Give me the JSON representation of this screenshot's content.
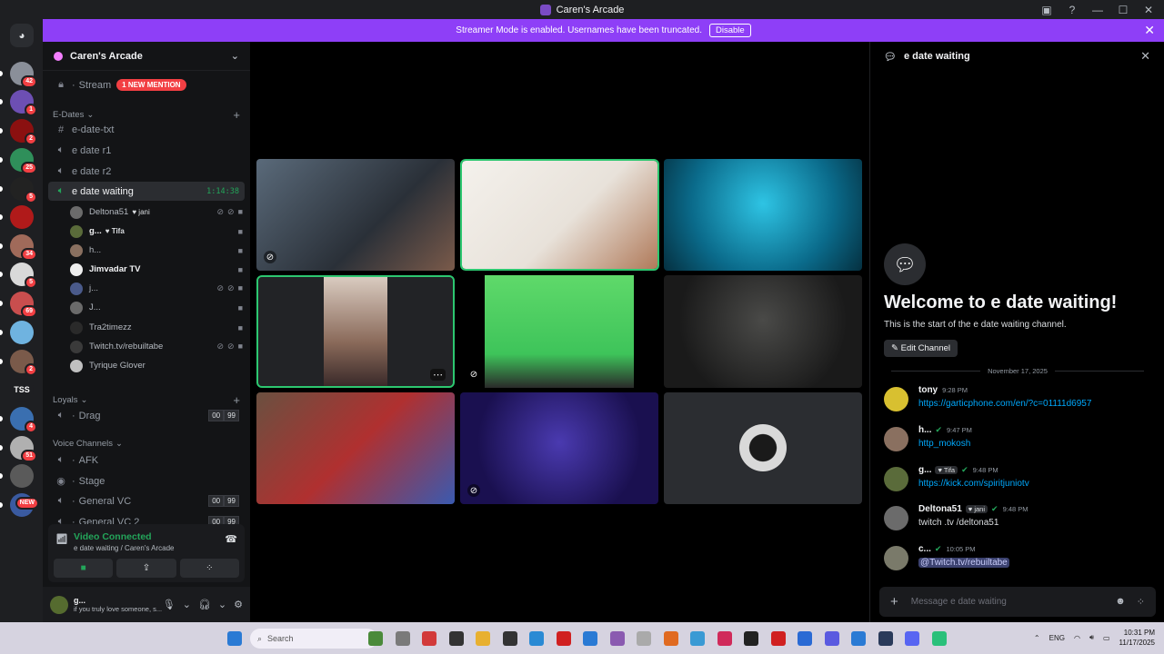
{
  "window": {
    "title": "Caren's Arcade"
  },
  "banner": {
    "text": "Streamer Mode is enabled. Usernames have been truncated.",
    "button": "Disable"
  },
  "rail": {
    "servers": [
      {
        "badge": "42",
        "color": "#8a8f99"
      },
      {
        "badge": "1",
        "color": "#6d4fb3"
      },
      {
        "badge": "2",
        "color": "#8b1010"
      },
      {
        "badge": "25",
        "color": "#2f8f5a"
      },
      {
        "badge": "5",
        "color": "#222222"
      },
      {
        "badge": "",
        "color": "#b01a1a"
      },
      {
        "badge": "34",
        "color": "#a06a5a"
      },
      {
        "badge": "5",
        "color": "#d9d9d9"
      },
      {
        "badge": "69",
        "color": "#c94e4e"
      },
      {
        "badge": "",
        "color": "#6fb3e0"
      },
      {
        "badge": "2",
        "color": "#7a5a4a"
      },
      {
        "badge": "TSS",
        "color": "#1e1f22"
      },
      {
        "badge": "4",
        "color": "#3a6fb0"
      },
      {
        "badge": "51",
        "color": "#b0b0b0"
      },
      {
        "badge": "",
        "color": "#5a5a5a"
      },
      {
        "badge": "NEW",
        "color": "#3a5aa0"
      }
    ]
  },
  "sidebar": {
    "server_name": "Caren's Arcade",
    "stream": {
      "name": "Stream",
      "mention": "1 NEW MENTION"
    },
    "cat_edates": "E-Dates",
    "channels": [
      "e-date-txt",
      "e date r1",
      "e date r2"
    ],
    "active": {
      "name": "e date waiting",
      "timer": "1:14:38"
    },
    "users": [
      {
        "name": "Deltona51",
        "tag": "♥ jani",
        "color": "#6b6b6b",
        "bold": false
      },
      {
        "name": "g...",
        "tag": "♥ Tifa",
        "color": "#5a6b3a",
        "bold": true
      },
      {
        "name": "h...",
        "tag": "",
        "color": "#8a7060",
        "bold": false
      },
      {
        "name": "Jimvadar TV",
        "tag": "",
        "color": "#eeeeee",
        "bold": true
      },
      {
        "name": "j...",
        "tag": "",
        "color": "#4a5a8a",
        "bold": false
      },
      {
        "name": "J...",
        "tag": "",
        "color": "#6a6a6a",
        "bold": false
      },
      {
        "name": "Tra2timezz",
        "tag": "",
        "color": "#2a2a2a",
        "bold": false
      },
      {
        "name": "Twitch.tv/rebuiltabe",
        "tag": "",
        "color": "#3a3a3a",
        "bold": false
      },
      {
        "name": "Tyrique Glover",
        "tag": "",
        "color": "#c0c0c0",
        "bold": false
      }
    ],
    "cat_loyals": "Loyals",
    "drag": {
      "name": "Drag",
      "a": "00",
      "b": "99"
    },
    "cat_voice": "Voice Channels",
    "voice": [
      {
        "name": "AFK"
      },
      {
        "name": "Stage"
      },
      {
        "name": "General VC",
        "a": "00",
        "b": "99"
      },
      {
        "name": "General VC 2",
        "a": "00",
        "b": "99"
      }
    ],
    "vc_panel": {
      "status": "Video Connected",
      "location": "e date waiting / Caren's Arcade"
    },
    "userbar": {
      "name": "g...",
      "status": "if you truly love someone, s..."
    }
  },
  "chat": {
    "channel": "e date waiting",
    "welcome_title": "Welcome to e date waiting!",
    "welcome_sub": "This is the start of the e date waiting channel.",
    "edit_button": "Edit Channel",
    "date": "November 17, 2025",
    "messages": [
      {
        "author": "tony",
        "time": "9:28 PM",
        "text": "https://garticphone.com/en/?c=01111d6957",
        "tag": "",
        "check": false,
        "av": "#d8c030"
      },
      {
        "author": "h...",
        "time": "9:47 PM",
        "text": "http_mokosh",
        "tag": "",
        "check": true,
        "av": "#8a7060"
      },
      {
        "author": "g...",
        "time": "9:48 PM",
        "text": "https://kick.com/spiritjuniotv",
        "tag": "♥ Tifa",
        "check": true,
        "av": "#5a6b3a"
      },
      {
        "author": "Deltona51",
        "time": "9:48 PM",
        "text": "twitch .tv /deltona51",
        "tag": "♥ jani",
        "check": true,
        "av": "#6b6b6b"
      },
      {
        "author": "c...",
        "time": "10:05 PM",
        "text": "@Twitch.tv/rebuiltabe",
        "tag": "",
        "check": true,
        "av": "#7a7a6a"
      }
    ],
    "composer_placeholder": "Message e date waiting"
  },
  "taskbar": {
    "search": "Search",
    "lang": "ENG",
    "time": "10:31 PM",
    "date": "11/17/2025"
  },
  "colors": {
    "accent": "#8e3ff7",
    "green": "#23a55a",
    "link": "#00a8fc"
  }
}
